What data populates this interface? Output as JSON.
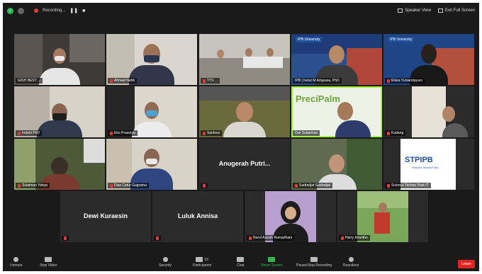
{
  "topbar": {
    "recording_label": "Recording...",
    "pause_symbol": "❚❚",
    "stop_symbol": "■",
    "speaker_view": "Speaker View",
    "exit_full_screen": "Exit Full Screen"
  },
  "participants": [
    {
      "name": "GISH BEST ...",
      "muted": false
    },
    {
      "name": "Ahmad Nafdi",
      "muted": true
    },
    {
      "name": "TTS ...",
      "muted": true
    },
    {
      "name": "IPB | Ketut M Artayasa, PhD",
      "muted": false
    },
    {
      "name": "Riska Yuniandayani",
      "muted": true
    },
    {
      "name": "Indarti PhD",
      "muted": true
    },
    {
      "name": "Eko Prasetyo",
      "muted": true
    },
    {
      "name": "Santoso",
      "muted": true
    },
    {
      "name": "Dwi Sulaeman",
      "muted": false
    },
    {
      "name": "Kudang",
      "muted": true
    },
    {
      "name": "Sulaiman Yahya",
      "muted": true
    },
    {
      "name": "Dias Catur Gugrama",
      "muted": true
    },
    {
      "name": "Anugerah Putri...",
      "muted": true
    },
    {
      "name": "Sudradjat Sudradjat",
      "muted": true
    },
    {
      "name": "Science Techno Park IT",
      "muted": true
    },
    {
      "name": "Dewi Kuraesin",
      "muted": true
    },
    {
      "name": "Luluk Annisa",
      "muted": true
    },
    {
      "name": "Nurul Azizah Ramadhani",
      "muted": true
    },
    {
      "name": "Harry Imantho",
      "muted": true
    }
  ],
  "tile_texts": {
    "ipb_logo": "IPB University",
    "precipalm": "PreciPalm",
    "stpipb": "STPIPB",
    "stpipb_sub": "Science Techno Park"
  },
  "toolbar": {
    "unmute": "Unmute",
    "stop_video": "Stop Video",
    "security": "Security",
    "participants": "Participants",
    "participants_count": "19",
    "chat": "Chat",
    "share_screen": "Share Screen",
    "pause_stop_recording": "Pause/Stop Recording",
    "reactions": "Reactions",
    "leave": "Leave"
  },
  "colors": {
    "active_speaker": "#9dff3a",
    "share_green": "#2db84c",
    "leave_red": "#e02424"
  }
}
